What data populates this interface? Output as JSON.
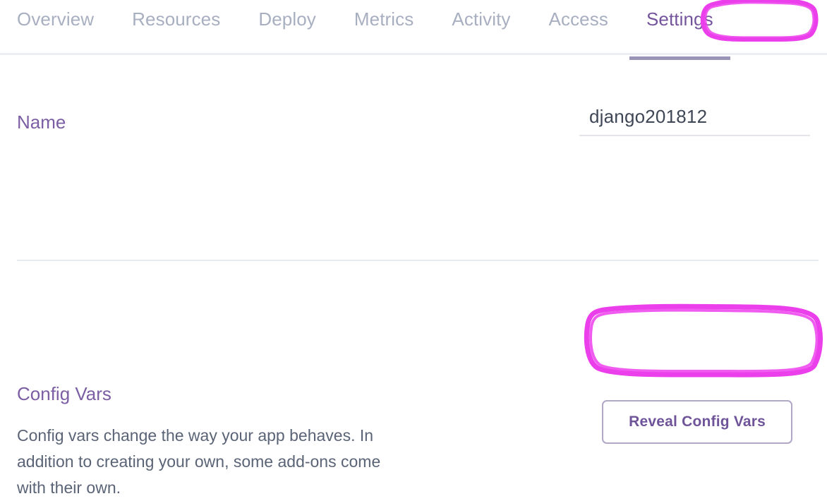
{
  "tabs": [
    {
      "label": "Overview",
      "active": false
    },
    {
      "label": "Resources",
      "active": false
    },
    {
      "label": "Deploy",
      "active": false
    },
    {
      "label": "Metrics",
      "active": false
    },
    {
      "label": "Activity",
      "active": false
    },
    {
      "label": "Access",
      "active": false
    },
    {
      "label": "Settings",
      "active": true
    }
  ],
  "name_section": {
    "label": "Name",
    "value": "django201812",
    "placeholder": "Name"
  },
  "config_section": {
    "heading": "Config Vars",
    "description": "Config vars change the way your app behaves. In addition to creating your own, some add-ons come with their own.",
    "reveal_button_label": "Reveal Config Vars"
  },
  "annotations": [
    {
      "name": "settings-tab-highlight",
      "target": "Settings",
      "shape": "rounded-rectangle",
      "color": "#ec3fec"
    },
    {
      "name": "reveal-config-vars-highlight",
      "target": "Reveal Config Vars",
      "shape": "rounded-rectangle",
      "color": "#ec3fec"
    }
  ],
  "colors": {
    "accent_purple": "#74559c",
    "tab_inactive": "#a8afc0",
    "body_text": "#5a6476",
    "annotation_magenta": "#ec3fec",
    "divider": "#e7eaef",
    "active_tab_underline": "#9a95b8",
    "button_border": "#b0a8c4"
  }
}
